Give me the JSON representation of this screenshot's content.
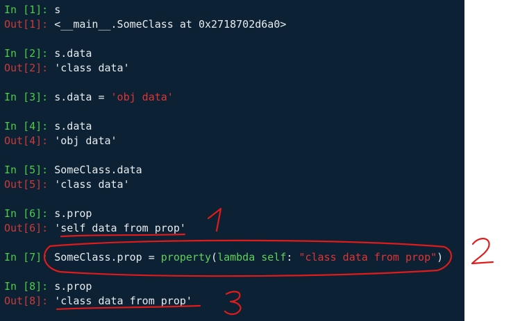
{
  "cells": [
    {
      "in_prompt": "In [1]:",
      "code": "s",
      "out_prompt": "Out[1]:",
      "output": "<__main__.SomeClass at 0x2718702d6a0>"
    },
    {
      "in_prompt": "In [2]:",
      "code": "s.data",
      "out_prompt": "Out[2]:",
      "output": "'class data'"
    },
    {
      "in_prompt": "In [3]:",
      "code_pre": "s.data = ",
      "code_str": "'obj data'"
    },
    {
      "in_prompt": "In [4]:",
      "code": "s.data",
      "out_prompt": "Out[4]:",
      "output": "'obj data'"
    },
    {
      "in_prompt": "In [5]:",
      "code": "SomeClass.data",
      "out_prompt": "Out[5]:",
      "output": "'class data'"
    },
    {
      "in_prompt": "In [6]:",
      "code": "s.prop",
      "out_prompt": "Out[6]:",
      "output": "'self data from prop'"
    },
    {
      "in_prompt": "In [7]:",
      "code_pre": "SomeClass.prop = ",
      "code_fn": "property",
      "code_paren_open": "(",
      "code_lambda": "lambda",
      "code_self": " self",
      "code_colon": ": ",
      "code_str": "\"class data from prop\"",
      "code_paren_close": ")"
    },
    {
      "in_prompt": "In [8]:",
      "code": "s.prop",
      "out_prompt": "Out[8]:",
      "output": "'class data from prop'"
    }
  ],
  "annotations": {
    "mark1": "1",
    "mark2": "2",
    "mark3": "3",
    "color": "#e01b1b"
  },
  "theme": {
    "background": "#0c2133",
    "in_prompt": "#4ecb48",
    "out_prompt": "#cc3a3a",
    "string": "#e03535",
    "text": "#e7ecef"
  }
}
